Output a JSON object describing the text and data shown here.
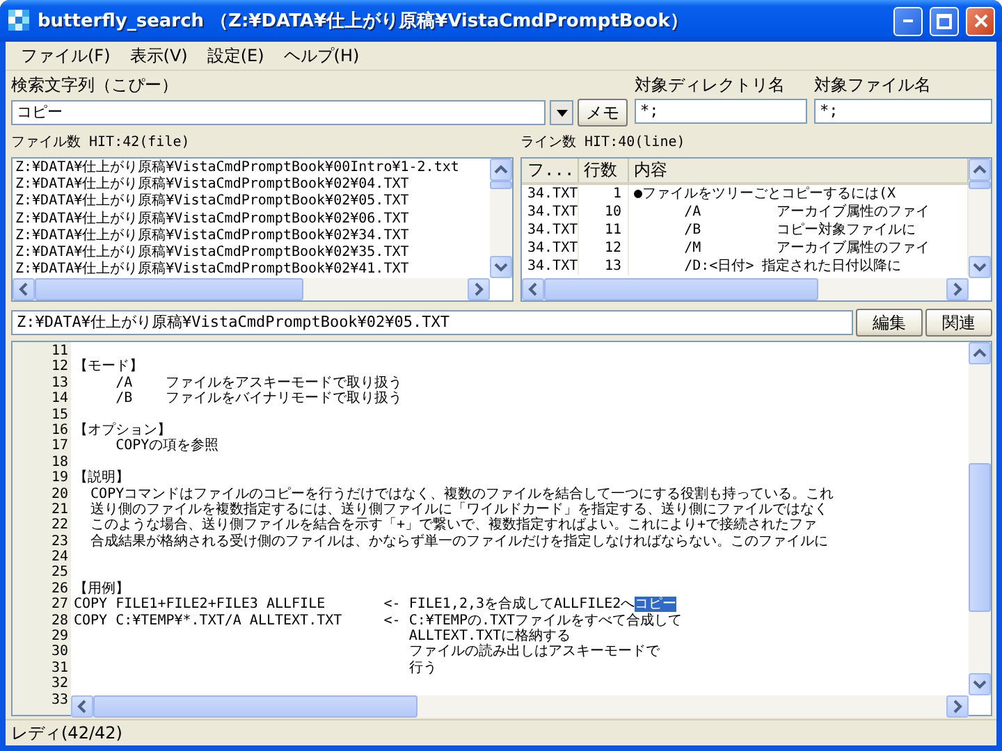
{
  "window": {
    "title": "butterfly_search （Z:¥DATA¥仕上がり原稿¥VistaCmdPromptBook）"
  },
  "menu": [
    "ファイル(F)",
    "表示(V)",
    "設定(E)",
    "ヘルプ(H)"
  ],
  "search": {
    "label": "検索文字列（こぴー）",
    "value": "コピー",
    "memo_button": "メモ"
  },
  "directory": {
    "label": "対象ディレクトリ名",
    "value": "*;"
  },
  "file_name": {
    "label": "対象ファイル名",
    "value": "*;"
  },
  "file_list": {
    "label": "ファイル数  HIT:42(file)",
    "items": [
      "Z:¥DATA¥仕上がり原稿¥VistaCmdPromptBook¥00Intro¥1-2.txt",
      "Z:¥DATA¥仕上がり原稿¥VistaCmdPromptBook¥02¥04.TXT",
      "Z:¥DATA¥仕上がり原稿¥VistaCmdPromptBook¥02¥05.TXT",
      "Z:¥DATA¥仕上がり原稿¥VistaCmdPromptBook¥02¥06.TXT",
      "Z:¥DATA¥仕上がり原稿¥VistaCmdPromptBook¥02¥34.TXT",
      "Z:¥DATA¥仕上がり原稿¥VistaCmdPromptBook¥02¥35.TXT",
      "Z:¥DATA¥仕上がり原稿¥VistaCmdPromptBook¥02¥41.TXT"
    ]
  },
  "line_list": {
    "label": "ライン数 HIT:40(line)",
    "columns": [
      "フ...",
      "行数",
      "内容"
    ],
    "rows": [
      [
        "34.TXT",
        "1",
        "●ファイルをツリーごとコピーするには(X"
      ],
      [
        "34.TXT",
        "10",
        "      /A         アーカイブ属性のファイ"
      ],
      [
        "34.TXT",
        "11",
        "      /B         コピー対象ファイルに"
      ],
      [
        "34.TXT",
        "12",
        "      /M         アーカイブ属性のファイ"
      ],
      [
        "34.TXT",
        "13",
        "      /D:<日付> 指定された日付以降に"
      ]
    ]
  },
  "path": {
    "value": "Z:¥DATA¥仕上がり原稿¥VistaCmdPromptBook¥02¥05.TXT",
    "buttons": [
      "編集",
      "関連"
    ]
  },
  "editor": {
    "lines": [
      {
        "number": "11"
      },
      {
        "number": "12",
        "text": "【モード】"
      },
      {
        "number": "13",
        "text": "     /A    ファイルをアスキーモードで取り扱う"
      },
      {
        "number": "14",
        "text": "     /B    ファイルをバイナリモードで取り扱う"
      },
      {
        "number": "15"
      },
      {
        "number": "16",
        "text": "【オプション】"
      },
      {
        "number": "17",
        "text": "     COPYの項を参照"
      },
      {
        "number": "18"
      },
      {
        "number": "19",
        "text": "【説明】"
      },
      {
        "number": "20",
        "text": "  COPYコマンドはファイルのコピーを行うだけではなく、複数のファイルを結合して一つにする役割も持っている。これ"
      },
      {
        "number": "21",
        "text": "  送り側のファイルを複数指定するには、送り側ファイルに「ワイルドカード」を指定する、送り側にファイルではなく"
      },
      {
        "number": "22",
        "text": "  このような場合、送り側ファイルを結合を示す「+」で繋いで、複数指定すればよい。これにより+で接続されたファ"
      },
      {
        "number": "23",
        "text": "  合成結果が格納される受け側のファイルは、かならず単一のファイルだけを指定しなければならない。このファイルに"
      },
      {
        "number": "24"
      },
      {
        "number": "25"
      },
      {
        "number": "26",
        "text": "【用例】"
      },
      {
        "number": "27",
        "text": "COPY FILE1+FILE2+FILE3 ALLFILE       <- FILE1,2,3を合成してALLFILE2へ",
        "selection": "コピー"
      },
      {
        "number": "28",
        "text": "COPY C:¥TEMP¥*.TXT/A ALLTEXT.TXT     <- C:¥TEMPの.TXTファイルをすべて合成して"
      },
      {
        "number": "29",
        "text": "                                        ALLTEXT.TXTに格納する"
      },
      {
        "number": "30",
        "text": "                                        ファイルの読み出しはアスキーモードで"
      },
      {
        "number": "31",
        "text": "                                        行う"
      },
      {
        "number": "32"
      },
      {
        "number": "33"
      }
    ]
  },
  "status_bar": "レディ(42/42)"
}
